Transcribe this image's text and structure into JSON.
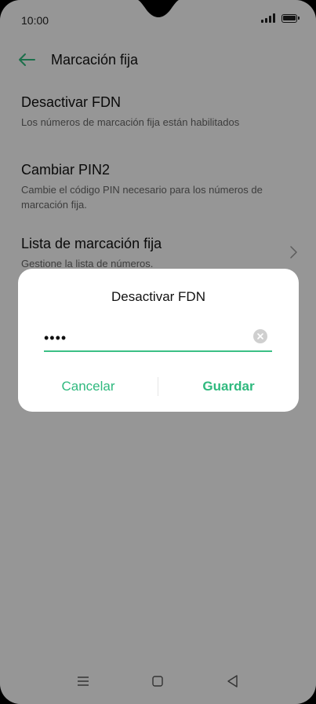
{
  "status_bar": {
    "time": "10:00"
  },
  "app_bar": {
    "title": "Marcación fija",
    "back_icon": "arrow-left-icon"
  },
  "settings": {
    "items": [
      {
        "title": "Desactivar FDN",
        "subtitle": "Los números de marcación fija están habilitados"
      },
      {
        "title": "Cambiar PIN2",
        "subtitle": "Cambie el código PIN necesario para los números de marcación fija."
      },
      {
        "title": "Lista de marcación fija",
        "subtitle": "Gestione la lista de números.",
        "trailing_icon": "chevron-right-icon"
      }
    ]
  },
  "dialog": {
    "title": "Desactivar FDN",
    "pin_value": "••••",
    "clear_icon": "clear-icon",
    "cancel_label": "Cancelar",
    "save_label": "Guardar"
  },
  "colors": {
    "accent": "#2fb97e",
    "scrim": "rgba(0,0,0,0.40)"
  }
}
